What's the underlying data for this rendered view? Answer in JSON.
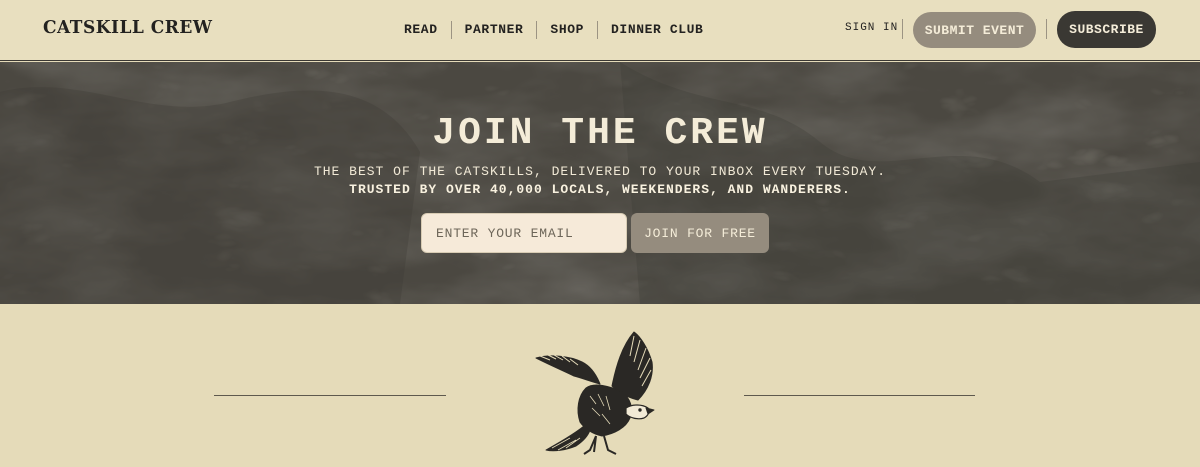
{
  "header": {
    "logo": "CATSKILL CREW",
    "nav": [
      {
        "label": "READ"
      },
      {
        "label": "PARTNER"
      },
      {
        "label": "SHOP"
      },
      {
        "label": "DINNER CLUB"
      }
    ],
    "sign_in": "SIGN IN",
    "submit_event": "SUBMIT EVENT",
    "subscribe": "SUBSCRIBE"
  },
  "hero": {
    "title": "JOIN THE CREW",
    "subtitle_line1": "THE BEST OF THE CATSKILLS, DELIVERED TO YOUR INBOX EVERY TUESDAY.",
    "subtitle_line2": "TRUSTED BY OVER 40,000 LOCALS, WEEKENDERS, AND WANDERERS.",
    "email_placeholder": "ENTER YOUR EMAIL",
    "email_value": "",
    "join_button": "JOIN FOR FREE"
  },
  "decoration": {
    "icon": "eagle-illustration"
  },
  "colors": {
    "page_background": "#e5dbb9",
    "hero_background": "#4a4740",
    "dark_button": "#3a3833",
    "muted_button": "#958c7e",
    "text_dark": "#232220",
    "text_light": "#f4ecd8"
  }
}
